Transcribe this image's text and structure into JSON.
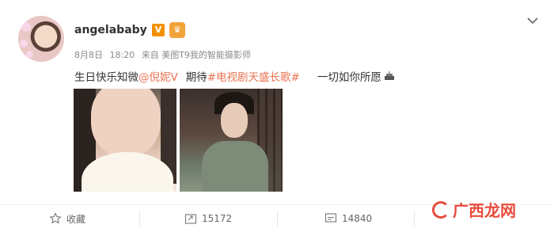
{
  "post": {
    "username": "angelababy",
    "verified_badge": "V",
    "meta": {
      "date": "8月8日",
      "time": "18:20",
      "source": "来自 美图T9我的智能摄影师"
    },
    "text": {
      "part1": "生日快乐知微",
      "mention": "@倪妮V",
      "part2": "期待",
      "topic": "#电视剧天盛长歌#",
      "part3": "一切如你所愿"
    }
  },
  "actions": {
    "favorite_label": "收藏",
    "repost_count": "15172",
    "comment_count": "14840"
  },
  "watermark": {
    "text": "广西龙网"
  },
  "icons": {
    "avatar": "avatar-image",
    "vip": "crown-icon",
    "more": "chevron-down-icon",
    "cake": "cake-icon",
    "favorite": "star-icon",
    "repost": "repost-icon",
    "comment": "comment-icon"
  },
  "colors": {
    "link": "#eb7350",
    "badge": "#f29100",
    "watermark": "#e74c3c"
  }
}
